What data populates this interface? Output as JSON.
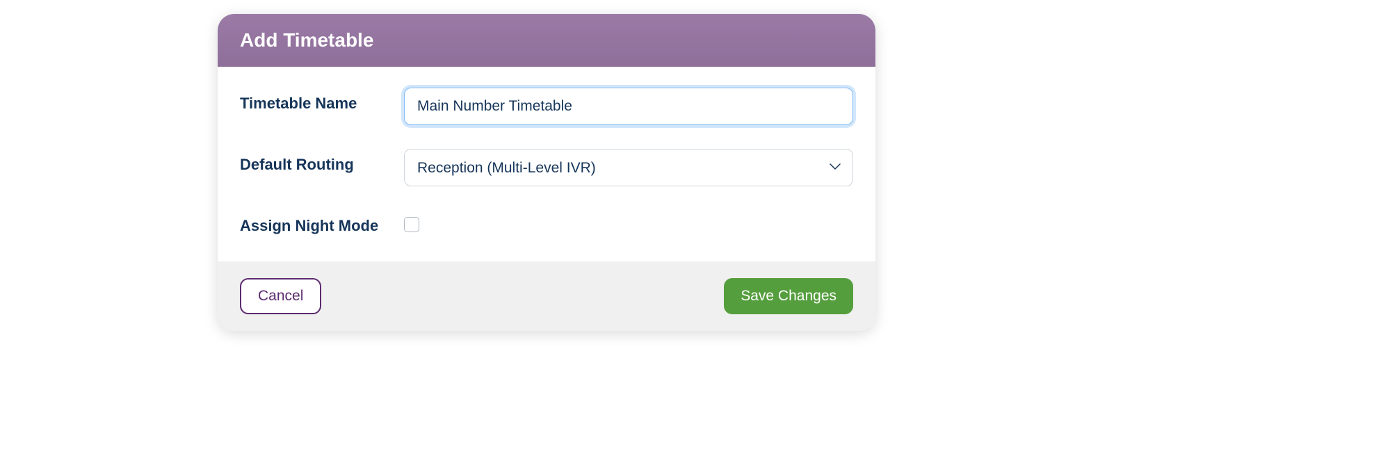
{
  "modal": {
    "title": "Add Timetable",
    "fields": {
      "timetable_name": {
        "label": "Timetable Name",
        "value": "Main Number Timetable"
      },
      "default_routing": {
        "label": "Default Routing",
        "value": "Reception (Multi-Level IVR)"
      },
      "assign_night_mode": {
        "label": "Assign Night Mode",
        "checked": false
      }
    },
    "buttons": {
      "cancel": "Cancel",
      "save": "Save Changes"
    }
  }
}
